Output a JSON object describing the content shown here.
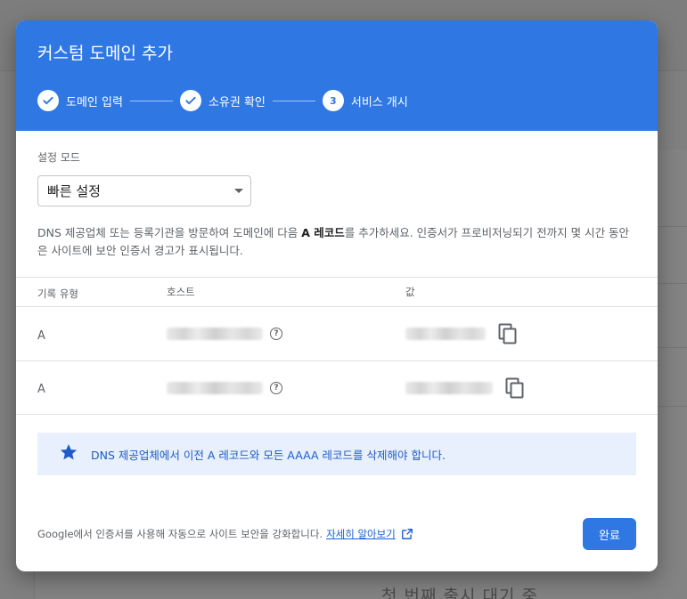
{
  "background": {
    "partial_text": "첫 번째 출시 대기 중"
  },
  "dialog": {
    "title": "커스텀 도메인 추가",
    "steps": [
      {
        "label": "도메인 입력",
        "state": "completed",
        "marker": ""
      },
      {
        "label": "소유권 확인",
        "state": "completed",
        "marker": ""
      },
      {
        "label": "서비스 개시",
        "state": "current",
        "marker": "3"
      }
    ]
  },
  "setup": {
    "mode_label": "설정 모드",
    "mode_value": "빠른 설정"
  },
  "instructions": {
    "before": "DNS 제공업체 또는 등록기관을 방문하여 도메인에 다음 ",
    "bold": "A 레코드",
    "after": "를 추가하세요. 인증서가 프로비저닝되기 전까지 몇 시간 동안은 사이트에 보안 인증서 경고가 표시됩니다."
  },
  "table": {
    "headers": {
      "type": "기록 유형",
      "host": "호스트",
      "value": "값"
    },
    "rows": [
      {
        "type": "A"
      },
      {
        "type": "A"
      }
    ]
  },
  "notice": {
    "text": "DNS 제공업체에서 이전 A 레코드와 모든 AAAA 레코드를 삭제해야 합니다.",
    "icon": "star-icon"
  },
  "footer": {
    "text": "Google에서 인증서를 사용해 자동으로 사이트 보안을 강화합니다.",
    "link": "자세히 알아보기",
    "done_label": "완료"
  },
  "colors": {
    "header": "#2f78e4",
    "notice_bg": "#e8f0fe",
    "notice_text": "#1f5bc6",
    "button": "#2f78e4"
  }
}
